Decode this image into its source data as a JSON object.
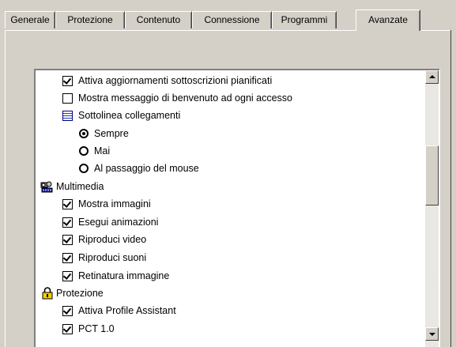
{
  "tabs": [
    {
      "label": "Generale"
    },
    {
      "label": "Protezione"
    },
    {
      "label": "Contenuto"
    },
    {
      "label": "Connessione"
    },
    {
      "label": "Programmi"
    },
    {
      "label": "Avanzate",
      "active": true
    }
  ],
  "settings": {
    "rows": [
      {
        "type": "checkbox",
        "checked": true,
        "label": "Attiva aggiornamenti sottoscrizioni pianificati"
      },
      {
        "type": "checkbox",
        "checked": false,
        "label": "Mostra messaggio di benvenuto ad ogni accesso"
      },
      {
        "type": "group-icon",
        "icon": "list-settings-icon",
        "label": "Sottolinea collegamenti"
      },
      {
        "type": "radio",
        "selected": true,
        "label": "Sempre"
      },
      {
        "type": "radio",
        "selected": false,
        "label": "Mai"
      },
      {
        "type": "radio",
        "selected": false,
        "label": "Al passaggio del mouse"
      },
      {
        "type": "category",
        "icon": "multimedia-icon",
        "label": "Multimedia"
      },
      {
        "type": "checkbox",
        "checked": true,
        "label": "Mostra immagini"
      },
      {
        "type": "checkbox",
        "checked": true,
        "label": "Esegui animazioni"
      },
      {
        "type": "checkbox",
        "checked": true,
        "label": "Riproduci video"
      },
      {
        "type": "checkbox",
        "checked": true,
        "label": "Riproduci suoni"
      },
      {
        "type": "checkbox",
        "checked": true,
        "label": "Retinatura immagine"
      },
      {
        "type": "category",
        "icon": "lock-icon",
        "label": "Protezione"
      },
      {
        "type": "checkbox",
        "checked": true,
        "label": "Attiva Profile Assistant"
      },
      {
        "type": "checkbox",
        "checked": true,
        "label": "PCT 1.0"
      }
    ]
  }
}
